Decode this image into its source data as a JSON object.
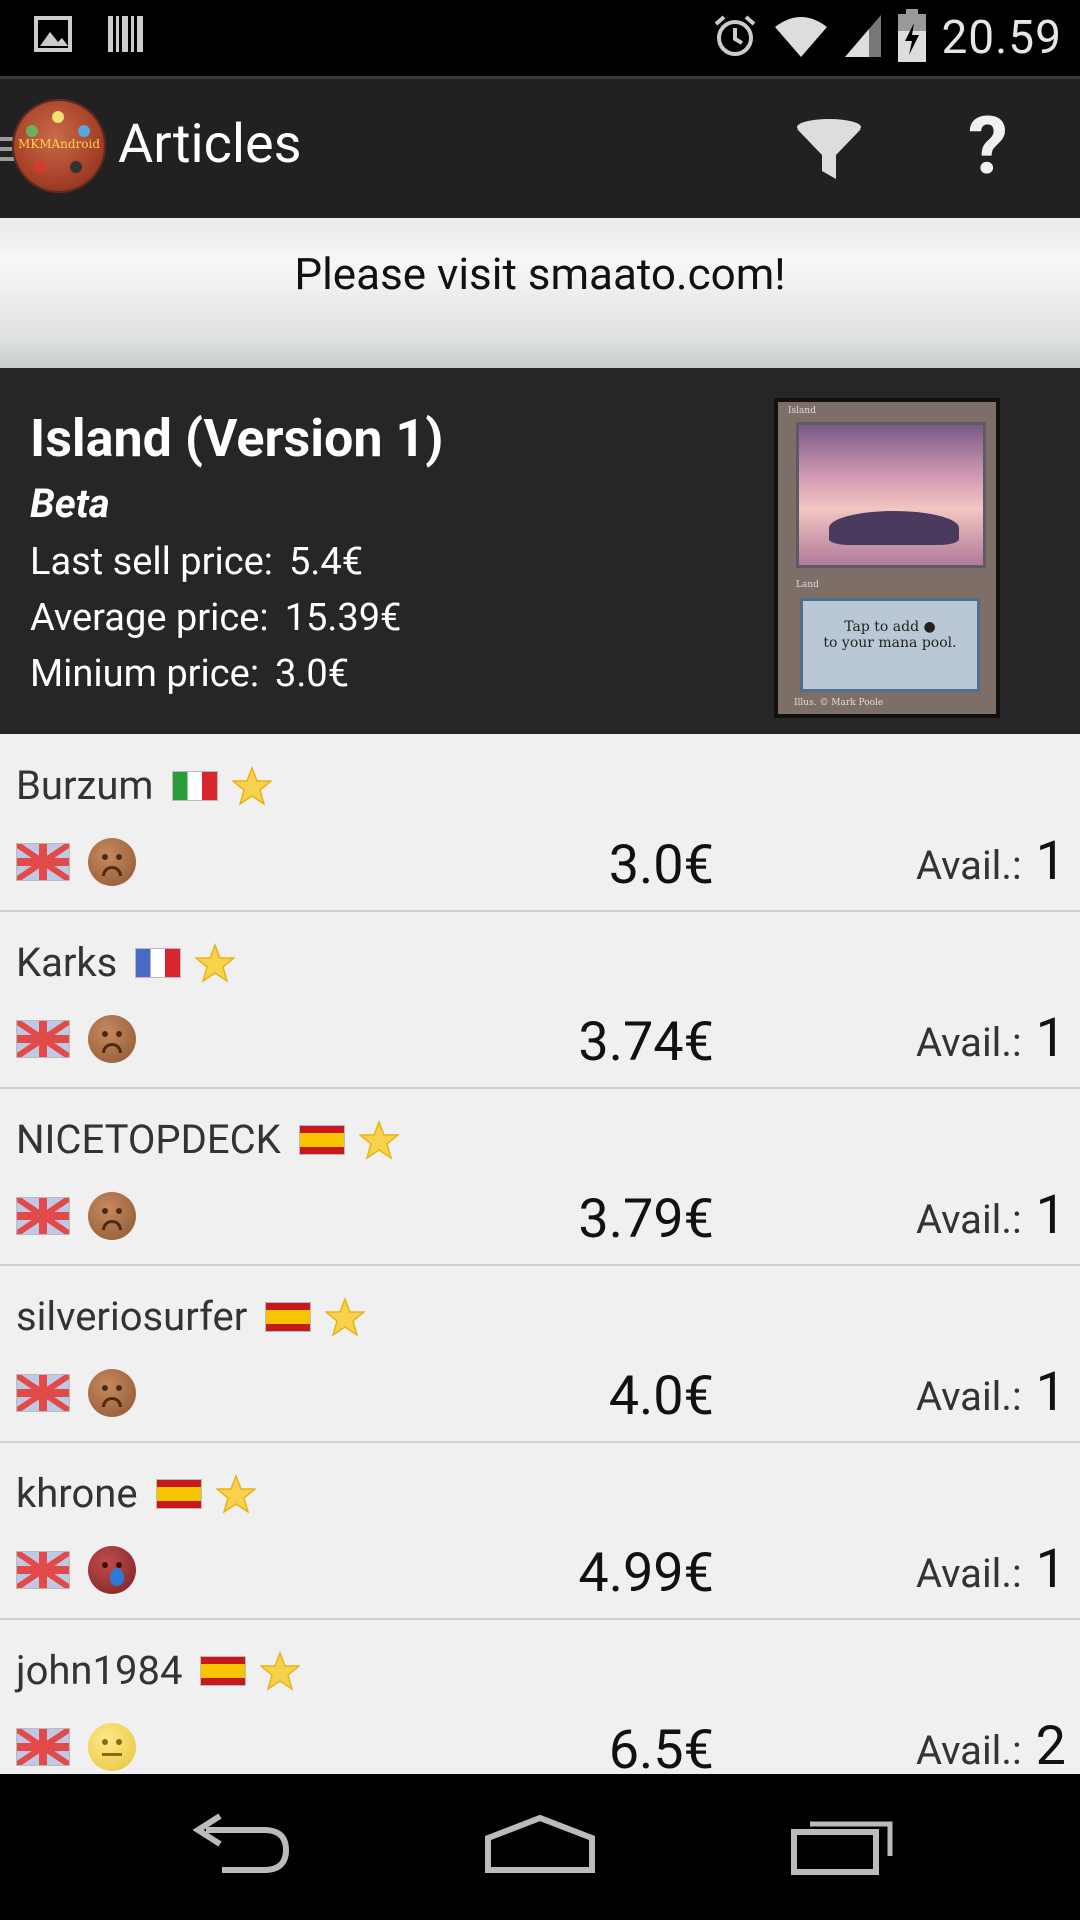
{
  "status_bar": {
    "time": "20.59",
    "left_icons": [
      "image-notification-icon",
      "barcode-notification-icon"
    ],
    "right_icons": [
      "alarm-icon",
      "wifi-icon",
      "signal-icon",
      "battery-icon"
    ]
  },
  "action_bar": {
    "title": "Articles",
    "logo_text": "MKMAndroid",
    "help_label": "?"
  },
  "ad": {
    "text": "Please visit smaato.com!"
  },
  "card": {
    "name": "Island (Version 1)",
    "edition": "Beta",
    "last_sell_label": "Last sell price:",
    "last_sell_value": "5.4€",
    "average_label": "Average price:",
    "average_value": "15.39€",
    "minimum_label": "Minium price:",
    "minimum_value": "3.0€",
    "image_text": {
      "rules": "Tap to add",
      "rules_end": "to your mana pool.",
      "name": "Island",
      "type": "Land",
      "artist": "Illus. © Mark Poole"
    }
  },
  "avail_label": "Avail.:",
  "sellers": [
    {
      "name": "Burzum",
      "country": "it",
      "price": "3.0€",
      "available": "1",
      "condition": "sad",
      "language": "uk"
    },
    {
      "name": "Karks",
      "country": "fr",
      "price": "3.74€",
      "available": "1",
      "condition": "sad",
      "language": "uk"
    },
    {
      "name": "NICETOPDECK",
      "country": "es",
      "price": "3.79€",
      "available": "1",
      "condition": "sad",
      "language": "uk"
    },
    {
      "name": "silveriosurfer",
      "country": "es",
      "price": "4.0€",
      "available": "1",
      "condition": "sad",
      "language": "uk"
    },
    {
      "name": "khrone",
      "country": "es",
      "price": "4.99€",
      "available": "1",
      "condition": "bad",
      "language": "uk"
    },
    {
      "name": "john1984",
      "country": "es",
      "price": "6.5€",
      "available": "2",
      "condition": "neutral",
      "language": "uk"
    }
  ],
  "nav_bar": {
    "buttons": [
      "back-icon",
      "home-icon",
      "recent-apps-icon"
    ]
  }
}
